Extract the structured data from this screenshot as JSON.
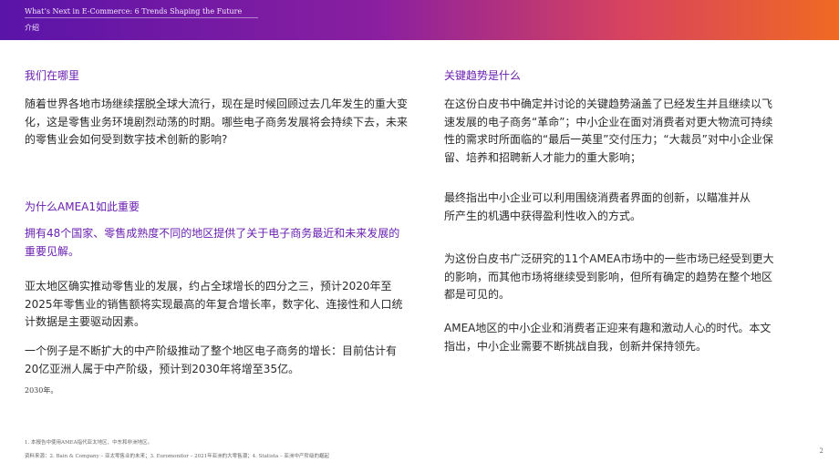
{
  "header": {
    "title": "What’s Next in E-Commerce: 6 Trends Shaping the Future",
    "subtitle": "介绍"
  },
  "left": {
    "where_heading": "我们在哪里",
    "where_text": "随着世界各地市场继续摆脱全球大流行，现在是时候回顾过去几年发生的重大变化，这是零售业务环境剧烈动荡的时期。哪些电子商务发展将会持续下去，未来的零售业会如何受到数字技术创新的影响?",
    "why_heading": "为什么AMEA1如此重要",
    "why_highlight": "拥有48个国家、零售成熟度不同的地区提供了关于电子商务最近和未来发展的重要见解。",
    "growth_text": "亚太地区确实推动零售业的发展，约占全球增长的四分之三，预计2020年至2025年零售业的销售额将实现最高的年复合增长率，数字化、连接性和人口统计数据是主要驱动因素。",
    "example_text": "一个例子是不断扩大的中产阶级推动了整个地区电子商务的增长：目前估计有20亿亚洲人属于中产阶级，预计到2030年将增至35亿。",
    "note_2030": "2030年。"
  },
  "right": {
    "trends_heading": "关键趋势是什么",
    "trends_text": "在这份白皮书中确定并讨论的关键趋势涵盖了已经发生并且继续以飞速发展的电子商务“革命”；中小企业在面对消费者对更大物流可持续性的需求时所面临的“最后一英里”交付压力；“大裁员”对中小企业保留、培养和招聘新人才能力的重大影响；",
    "final_text": "最终指出中小企业可以利用围绕消费者界面的创新，以瞄准并从所产生的机遇中获得盈利性收入的方式。",
    "research_text": "为这份白皮书广泛研究的11个AMEA市场中的一些市场已经受到更大的影响，而其他市场将继续受到影响，但所有确定的趋势在整个地区都是可见的。",
    "era_text": "AMEA地区的中小企业和消费者正迎来有趣和激动人心的时代。本文指出，中小企业需要不断挑战自我，创新并保持领先。"
  },
  "footer": {
    "footnote1": "1. 本报告中使用AMEA指代亚太地区、中东和非洲地区。",
    "footnote2": "资料来源：2. Bain & Company – 亚太零售业的未来；3. Euromonitor – 2021年亚洲的大零售潮；4. Statista – 亚洲中产阶级的崛起",
    "page_number": "2"
  },
  "colors": {
    "accent_purple": "#6a1fb0",
    "header_gradient_start": "#5a14a8",
    "header_gradient_end": "#f06a22"
  }
}
